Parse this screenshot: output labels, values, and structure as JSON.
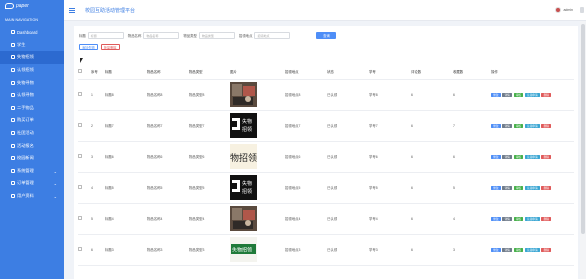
{
  "sidebar": {
    "logo_text": "paper",
    "nav_header": "MAIN NAVIGATION",
    "items": [
      {
        "label": "Dashboard",
        "icon": "home-icon",
        "active": false,
        "expandable": false
      },
      {
        "label": "学生",
        "icon": "user-icon",
        "active": false,
        "expandable": false
      },
      {
        "label": "失物招领",
        "icon": "list-icon",
        "active": true,
        "expandable": false
      },
      {
        "label": "认领招领",
        "icon": "list-icon",
        "active": false,
        "expandable": false
      },
      {
        "label": "失物寻物",
        "icon": "list-icon",
        "active": false,
        "expandable": false
      },
      {
        "label": "认领寻物",
        "icon": "list-icon",
        "active": false,
        "expandable": false
      },
      {
        "label": "二手物品",
        "icon": "list-icon",
        "active": false,
        "expandable": false
      },
      {
        "label": "购买订单",
        "icon": "list-icon",
        "active": false,
        "expandable": false
      },
      {
        "label": "社团活动",
        "icon": "list-icon",
        "active": false,
        "expandable": false
      },
      {
        "label": "活动报名",
        "icon": "list-icon",
        "active": false,
        "expandable": false
      },
      {
        "label": "校园新闻",
        "icon": "list-icon",
        "active": false,
        "expandable": false
      },
      {
        "label": "系统管理",
        "icon": "list-icon",
        "active": false,
        "expandable": true
      },
      {
        "label": "订单管理",
        "icon": "list-icon",
        "active": false,
        "expandable": true
      },
      {
        "label": "用户资料",
        "icon": "list-icon",
        "active": false,
        "expandable": true
      }
    ]
  },
  "header": {
    "title": "校园互助活动管理平台",
    "user_name": "admin"
  },
  "search": {
    "fields": [
      {
        "label": "标题",
        "placeholder": "标题"
      },
      {
        "label": "物品名称",
        "placeholder": "物品名称"
      },
      {
        "label": "物品类型",
        "placeholder": "物品类型"
      },
      {
        "label": "招领地点",
        "placeholder": "招领地点"
      }
    ],
    "button": "查询"
  },
  "actions": {
    "add": "添加失物",
    "delete": "批量删除"
  },
  "table": {
    "headers": [
      "",
      "序号",
      "标题",
      "物品名称",
      "物品类型",
      "图片",
      "招领地点",
      "状态",
      "学号",
      "评论数",
      "收藏数",
      "操作"
    ],
    "rows": [
      {
        "idx": "1",
        "title": "标题8",
        "name": "物品名称8",
        "type": "物品类型8",
        "image": "photo",
        "place": "招领地点8",
        "status": "已认领",
        "sno": "学号8",
        "comments": "6",
        "favs": "6"
      },
      {
        "idx": "2",
        "title": "标题7",
        "name": "物品名称7",
        "type": "物品类型7",
        "image": "poster-black",
        "place": "招领地点7",
        "status": "已认领",
        "sno": "学号7",
        "comments": "6",
        "favs": "7"
      },
      {
        "idx": "3",
        "title": "标题6",
        "name": "物品名称6",
        "type": "物品类型6",
        "image": "poster-text",
        "place": "招领地点6",
        "status": "已认领",
        "sno": "学号6",
        "comments": "6",
        "favs": "6"
      },
      {
        "idx": "4",
        "title": "标题5",
        "name": "物品名称5",
        "type": "物品类型5",
        "image": "poster-black",
        "place": "招领地点5",
        "status": "已认领",
        "sno": "学号5",
        "comments": "6",
        "favs": "5"
      },
      {
        "idx": "5",
        "title": "标题4",
        "name": "物品名称4",
        "type": "物品类型4",
        "image": "photo",
        "place": "招领地点4",
        "status": "已认领",
        "sno": "学号4",
        "comments": "6",
        "favs": "4"
      },
      {
        "idx": "6",
        "title": "标题3",
        "name": "物品名称3",
        "type": "物品类型3",
        "image": "poster-green",
        "place": "招领地点3",
        "status": "已认领",
        "sno": "学号3",
        "comments": "6",
        "favs": "3"
      }
    ],
    "ops": [
      {
        "label": "修改",
        "kind": "edit"
      },
      {
        "label": "详情",
        "kind": "detail"
      },
      {
        "label": "审核",
        "kind": "audit"
      },
      {
        "label": "认领申请",
        "kind": "apply"
      },
      {
        "label": "删除",
        "kind": "delete"
      }
    ],
    "poster_texts": {
      "poster-black": "失物招领",
      "poster-text": "物招领",
      "poster-green": "失物招领"
    }
  },
  "colors": {
    "sidebar": "#3d7ee3",
    "primary": "#4e8ef7",
    "danger": "#e05a5a",
    "success": "#47b04b",
    "info": "#3aa6d3",
    "muted": "#6f7b8a"
  }
}
